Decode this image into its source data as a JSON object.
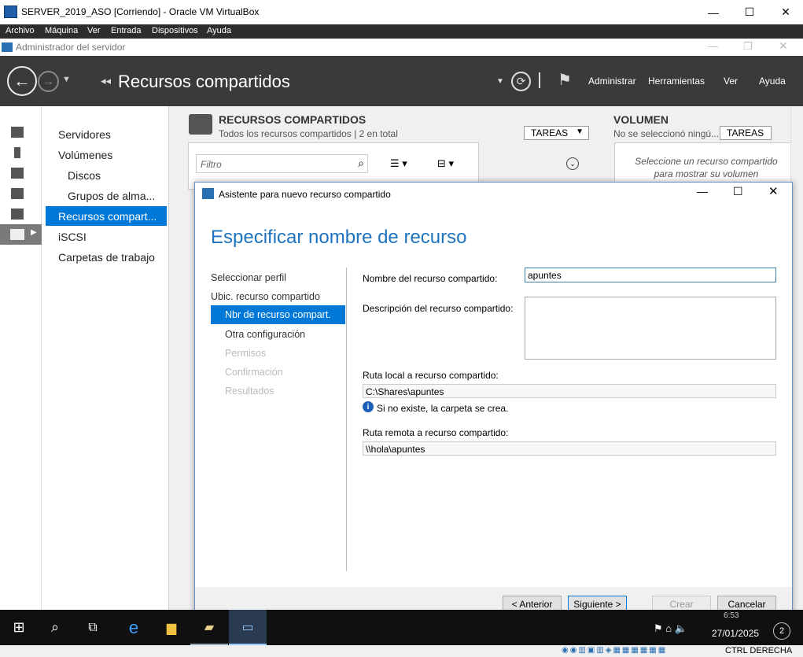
{
  "vbox": {
    "title": "SERVER_2019_ASO [Corriendo] - Oracle VM VirtualBox",
    "menu": [
      "Archivo",
      "Máquina",
      "Ver",
      "Entrada",
      "Dispositivos",
      "Ayuda"
    ],
    "minimize": "—",
    "maximize": "☐",
    "close": "✕",
    "status_text": "CTRL DERECHA"
  },
  "server_manager": {
    "title": "Administrador del servidor",
    "breadcrumb_arrows": "◂◂",
    "breadcrumb": "Recursos compartidos",
    "header_menu": [
      "Administrar",
      "Herramientas",
      "Ver",
      "Ayuda"
    ],
    "nav_items": [
      "Servidores",
      "Volúmenes",
      "Discos",
      "Grupos de alma...",
      "Recursos compart...",
      "iSCSI",
      "Carpetas de trabajo"
    ],
    "shares": {
      "title": "RECURSOS COMPARTIDOS",
      "subtitle": "Todos los recursos compartidos | 2 en total",
      "tasks": "TAREAS",
      "filter_placeholder": "Filtro"
    },
    "volume": {
      "title": "VOLUMEN",
      "subtitle": "No se seleccionó ningú...",
      "tasks": "TAREAS",
      "hint_line1": "Seleccione un recurso compartido",
      "hint_line2": "para mostrar su volumen"
    }
  },
  "wizard": {
    "title": "Asistente para nuevo recurso compartido",
    "heading": "Especificar nombre de recurso",
    "steps": [
      {
        "label": "Seleccionar perfil",
        "state": "done"
      },
      {
        "label": "Ubic. recurso compartido",
        "state": "done"
      },
      {
        "label": "Nbr de recurso compart.",
        "state": "active"
      },
      {
        "label": "Otra configuración",
        "state": "pending"
      },
      {
        "label": "Permisos",
        "state": "disabled"
      },
      {
        "label": "Confirmación",
        "state": "disabled"
      },
      {
        "label": "Resultados",
        "state": "disabled"
      }
    ],
    "share_name_label": "Nombre del recurso compartido:",
    "share_name_value": "apuntes",
    "description_label": "Descripción del recurso compartido:",
    "description_value": "",
    "local_path_label": "Ruta local a recurso compartido:",
    "local_path_value": "C:\\Shares\\apuntes",
    "info_note": "Si no existe, la carpeta se crea.",
    "remote_path_label": "Ruta remota a recurso compartido:",
    "remote_path_value": "\\\\hola\\apuntes",
    "buttons": {
      "previous": "< Anterior",
      "next": "Siguiente >",
      "create": "Crear",
      "cancel": "Cancelar"
    }
  },
  "taskbar": {
    "time": "6:53",
    "date": "27/01/2025",
    "notification_count": "2"
  },
  "colors": {
    "accent": "#0078d7",
    "header_bg": "#3a3a3a",
    "wizard_heading": "#1e73be"
  }
}
